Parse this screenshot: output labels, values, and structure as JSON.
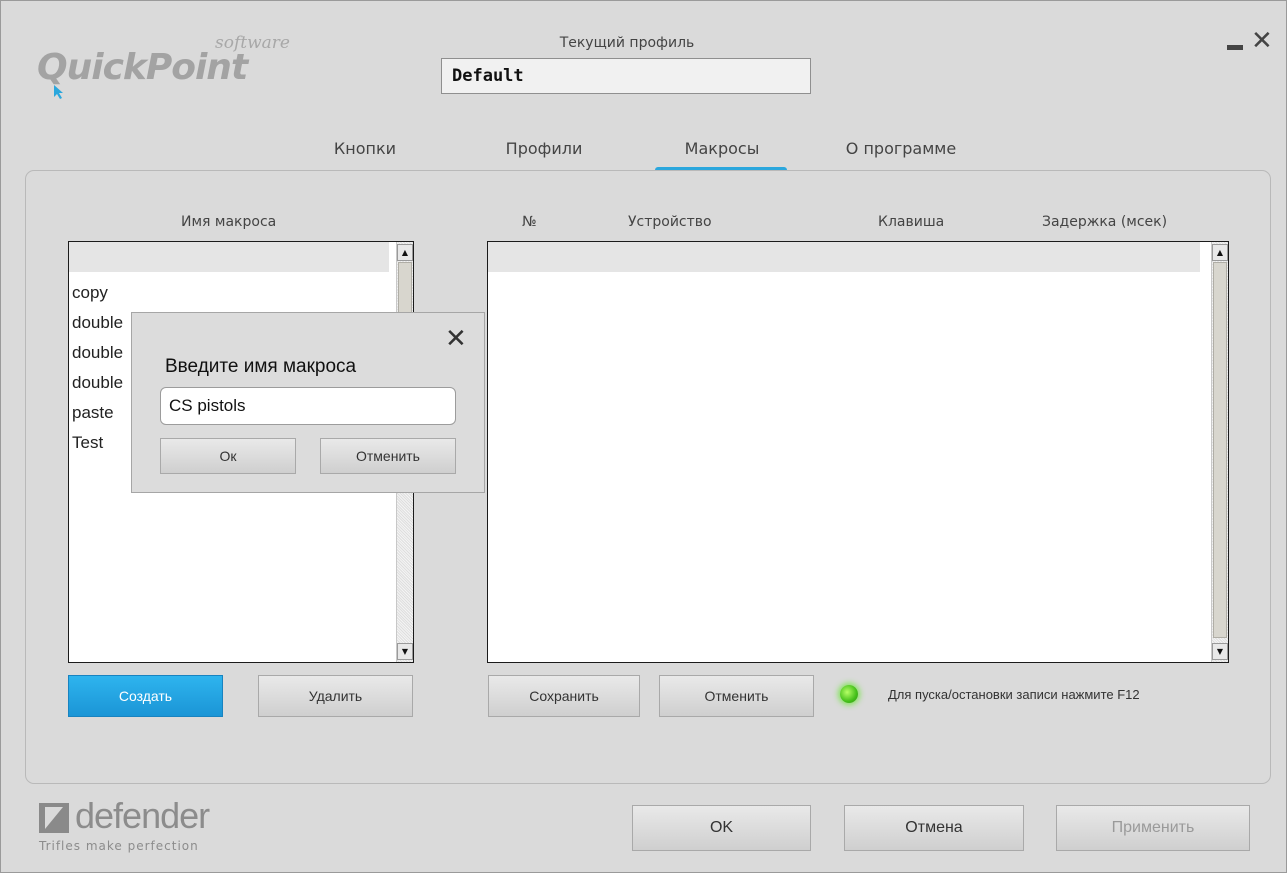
{
  "app": {
    "logo_main": "QuickPoint",
    "logo_sub": "software"
  },
  "profile": {
    "label": "Текущий профиль",
    "value": "Default"
  },
  "tabs": [
    {
      "label": "Кнопки",
      "active": false
    },
    {
      "label": "Профили",
      "active": false
    },
    {
      "label": "Макросы",
      "active": true
    },
    {
      "label": "О программе",
      "active": false
    }
  ],
  "accent_color": "#2ba7dd",
  "macros": {
    "list_header": "Имя макроса",
    "items": [
      "",
      "copy",
      "double",
      "double",
      "double",
      "paste",
      "Test"
    ],
    "create_label": "Создать",
    "delete_label": "Удалить"
  },
  "steps": {
    "columns": [
      "№",
      "Устройство",
      "Клавиша",
      "Задержка (мсек)"
    ],
    "save_label": "Сохранить",
    "cancel_label": "Отменить",
    "hint": "Для пуска/остановки записи нажмите F12"
  },
  "dialog": {
    "title": "Введите имя макроса",
    "input_value": "CS pistols",
    "ok_label": "Ок",
    "cancel_label": "Отменить"
  },
  "footer": {
    "brand_name": "defender",
    "brand_slogan": "Trifles make perfection",
    "ok_label": "OK",
    "cancel_label": "Отмена",
    "apply_label": "Применить"
  }
}
